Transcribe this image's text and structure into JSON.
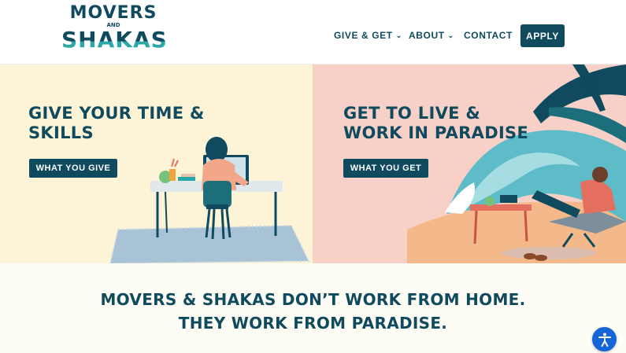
{
  "header": {
    "logo": {
      "line1": "MOVERS",
      "line2": "AND",
      "line3": "SHAKAS"
    },
    "nav": [
      {
        "label": "GIVE & GET",
        "has_dropdown": true
      },
      {
        "label": "ABOUT",
        "has_dropdown": true
      },
      {
        "label": "CONTACT",
        "has_dropdown": false
      }
    ],
    "apply_label": "APPLY"
  },
  "hero": {
    "left": {
      "title_line1": "GIVE YOUR TIME &",
      "title_line2": "SKILLS",
      "button": "WHAT YOU GIVE"
    },
    "right": {
      "title_line1": "GET TO LIVE &",
      "title_line2": "WORK IN PARADISE",
      "button": "WHAT YOU GET"
    }
  },
  "tagline": {
    "line1": "MOVERS & SHAKAS DON’T WORK FROM HOME.",
    "line2": "THEY WORK FROM PARADISE."
  },
  "accessibility": {
    "icon": "accessibility-icon"
  },
  "colors": {
    "brand_dark": "#0f4a5e",
    "brand_teal": "#2aa7a9",
    "left_panel_bg": "#fdf3d6",
    "right_panel_bg": "#f7d1c8",
    "a11y_blue": "#1565d8"
  }
}
